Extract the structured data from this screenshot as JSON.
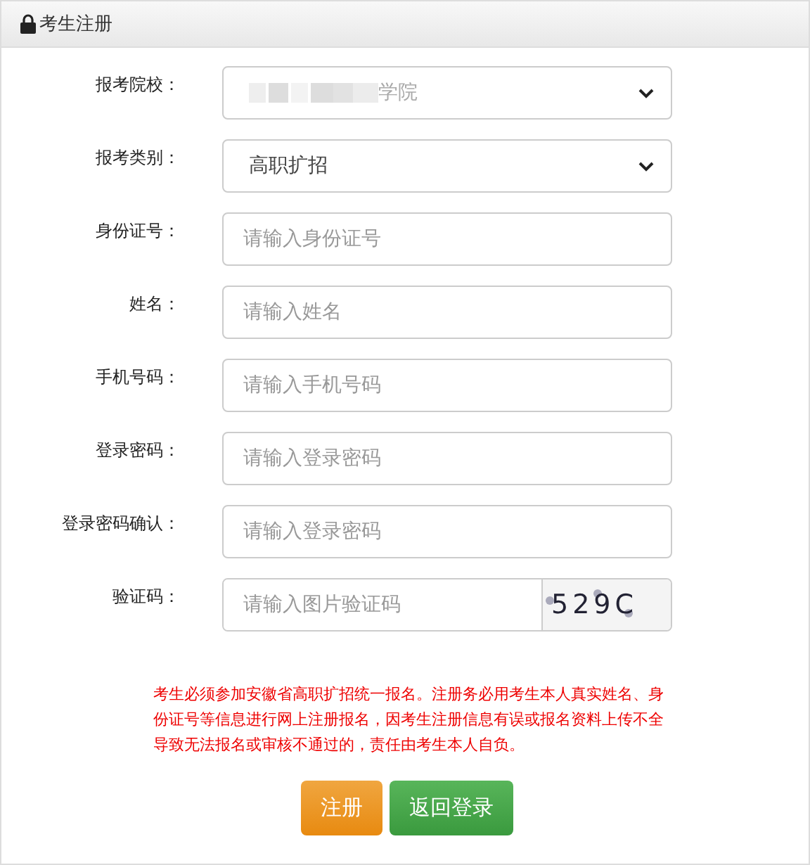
{
  "panel": {
    "title": "考生注册"
  },
  "fields": [
    {
      "kind": "select",
      "label": "报考院校：",
      "value": "学院",
      "redacted": true
    },
    {
      "kind": "select",
      "label": "报考类别：",
      "value": "高职扩招",
      "redacted": false
    },
    {
      "kind": "input",
      "label": "身份证号：",
      "placeholder": "请输入身份证号"
    },
    {
      "kind": "input",
      "label": "姓名：",
      "placeholder": "请输入姓名"
    },
    {
      "kind": "input",
      "label": "手机号码：",
      "placeholder": "请输入手机号码"
    },
    {
      "kind": "input",
      "label": "登录密码：",
      "placeholder": "请输入登录密码"
    },
    {
      "kind": "input",
      "label": "登录密码确认：",
      "placeholder": "请输入登录密码"
    },
    {
      "kind": "captcha",
      "label": "验证码：",
      "placeholder": "请输入图片验证码",
      "captcha": "529C"
    }
  ],
  "notice": "考生必须参加安徽省高职扩招统一报名。注册务必用考生本人真实姓名、身份证号等信息进行网上注册报名，因考生注册信息有误或报名资料上传不全导致无法报名或审核不通过的，责任由考生本人自负。",
  "buttons": [
    {
      "kind": "primary",
      "label": "注册"
    },
    {
      "kind": "secondary",
      "label": "返回登录"
    }
  ]
}
